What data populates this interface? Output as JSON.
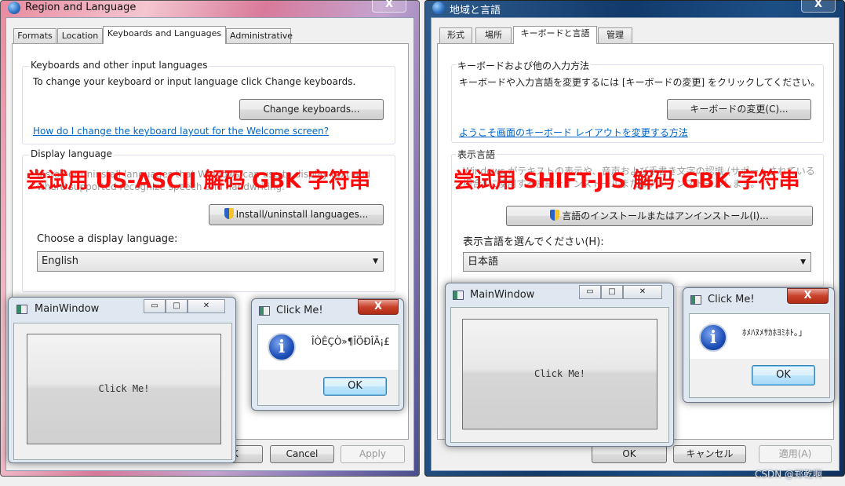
{
  "left": {
    "title": "Region and Language",
    "close": "X",
    "tabs": [
      "Formats",
      "Location",
      "Keyboards and Languages",
      "Administrative"
    ],
    "keyboards_group": {
      "title": "Keyboards and other input languages",
      "desc": "To change your keyboard or input language click Change keyboards.",
      "button": "Change keyboards...",
      "link": "How do I change the keyboard layout for the Welcome screen?"
    },
    "display_group": {
      "title": "Display language",
      "desc": "Install or uninstall languages that Windows can use to display text and where supported recognize speech and handwriting.",
      "install_button": "Install/uninstall languages...",
      "choose_label": "Choose a display language:",
      "selected": "English"
    },
    "footer": {
      "ok": "OK",
      "cancel": "Cancel",
      "apply": "Apply"
    },
    "overlay": "尝试用 US-ASCII 解码 GBK 字符串",
    "main_window": {
      "title": "MainWindow",
      "minimize": "▭",
      "maximize": "□",
      "close": "✕",
      "button": "Click Me!"
    },
    "message_box": {
      "title": "Click Me!",
      "close": "X",
      "message": "ÎÒÊÇÒ»¶ÎÖÐÎÄ¡£",
      "ok": "OK"
    }
  },
  "right": {
    "title": "地域と言語",
    "close": "X",
    "tabs": [
      "形式",
      "場所",
      "キーボードと言語",
      "管理"
    ],
    "keyboards_group": {
      "title": "キーボードおよび他の入力方法",
      "desc": "キーボードや入力言語を変更するには [キーボードの変更] をクリックしてください。",
      "button": "キーボードの変更(C)...",
      "link": "ようこそ画面のキーボード レイアウトを変更する方法"
    },
    "display_group": {
      "title": "表示言語",
      "desc": "Windows がテキストの表示や、音声および手書き文字の認識 (サポートされている場合) に使用する言語をインストールまたはアンインストールします。",
      "install_button": "言語のインストールまたはアンインストール(I)...",
      "choose_label": "表示言語を選んでください(H):",
      "selected": "日本語"
    },
    "footer": {
      "ok": "OK",
      "cancel": "キャンセル",
      "apply": "適用(A)"
    },
    "overlay": "尝试用 SHIFT-JIS 解码 GBK 字符串",
    "main_window": {
      "title": "MainWindow",
      "minimize": "▭",
      "maximize": "□",
      "close": "✕",
      "button": "Click Me!"
    },
    "message_box": {
      "title": "Click Me!",
      "close": "X",
      "message": "ﾎﾒﾊﾇﾒｻｶﾎﾖﾐﾎﾄ｡｣",
      "ok": "OK"
    }
  },
  "watermark": "CSDN @郑乾啊",
  "colors": {
    "overlay_text": "#ff0a0a",
    "link": "#0066cc",
    "close_red": "#c8412b"
  }
}
